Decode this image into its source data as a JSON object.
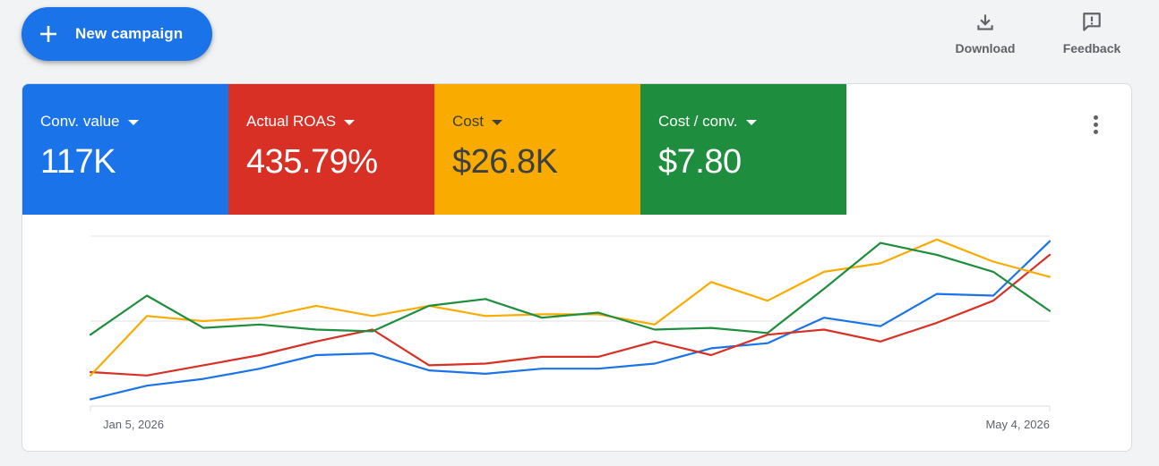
{
  "toolbar": {
    "new_campaign_label": "New campaign",
    "download_label": "Download",
    "feedback_label": "Feedback"
  },
  "scorecards": [
    {
      "name": "Conv. value",
      "value": "117K",
      "color": "#1a73e8",
      "text_color": "#ffffff"
    },
    {
      "name": "Actual ROAS",
      "value": "435.79%",
      "color": "#d93025",
      "text_color": "#ffffff"
    },
    {
      "name": "Cost",
      "value": "$26.8K",
      "color": "#f9ab00",
      "text_color": "#3c4043"
    },
    {
      "name": "Cost / conv.",
      "value": "$7.80",
      "color": "#1e8e3e",
      "text_color": "#ffffff"
    }
  ],
  "chart_data": {
    "type": "line",
    "x": [
      "Jan 5, 2026",
      "Jan 12, 2026",
      "Jan 19, 2026",
      "Jan 26, 2026",
      "Feb 2, 2026",
      "Feb 9, 2026",
      "Feb 16, 2026",
      "Feb 23, 2026",
      "Mar 2, 2026",
      "Mar 9, 2026",
      "Mar 16, 2026",
      "Mar 23, 2026",
      "Mar 30, 2026",
      "Apr 6, 2026",
      "Apr 13, 2026",
      "Apr 20, 2026",
      "Apr 27, 2026",
      "May 4, 2026"
    ],
    "tick_labels": [
      "Jan 5, 2026",
      "May 4, 2026"
    ],
    "ylim": [
      0,
      100
    ],
    "grid": true,
    "series": [
      {
        "metric": "Conv. value",
        "color": "#1a73e8",
        "values": [
          4,
          12,
          16,
          22,
          30,
          31,
          21,
          19,
          22,
          22,
          25,
          34,
          37,
          52,
          47,
          66,
          65,
          97
        ]
      },
      {
        "metric": "Actual ROAS",
        "color": "#d93025",
        "values": [
          20,
          18,
          24,
          30,
          38,
          45,
          24,
          25,
          29,
          29,
          38,
          30,
          42,
          45,
          38,
          49,
          62,
          89
        ]
      },
      {
        "metric": "Cost",
        "color": "#f9ab00",
        "values": [
          18,
          53,
          50,
          52,
          59,
          53,
          59,
          53,
          54,
          54,
          48,
          73,
          62,
          79,
          84,
          98,
          85,
          76
        ]
      },
      {
        "metric": "Cost / conv.",
        "color": "#1e8e3e",
        "values": [
          42,
          65,
          46,
          48,
          45,
          44,
          59,
          63,
          52,
          55,
          45,
          46,
          43,
          69,
          96,
          89,
          79,
          56
        ]
      }
    ]
  }
}
